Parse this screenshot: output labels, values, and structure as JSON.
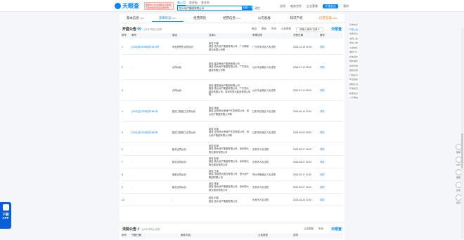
{
  "header": {
    "logo_text": "天眼查",
    "promo_text": "国家中小企业发展子基金旗下官方备案企业征信机构",
    "top_tabs": [
      "查公司",
      "查老板",
      "查关系"
    ],
    "search_value": "恒大地产集团有限公司",
    "search_button": "天眼一下",
    "search_clear": "清空",
    "right_items": [
      "应用",
      "商务合作",
      "企业套餐",
      "开通会员",
      "我的"
    ]
  },
  "nav": {
    "tabs": [
      {
        "label": "基本信息",
        "count": "999+"
      },
      {
        "label": "法律诉讼",
        "count": "999+"
      },
      {
        "label": "经营风险",
        "count": ""
      },
      {
        "label": "经营信息",
        "count": "999+"
      },
      {
        "label": "公司发展",
        "count": ""
      },
      {
        "label": "知识产权",
        "count": ""
      },
      {
        "label": "历史信息",
        "count": "999+"
      }
    ]
  },
  "section1": {
    "title": "开庭公告",
    "count": "99",
    "sub": "近5年开庭公告数",
    "filters": [
      "案由",
      "角色",
      "年份",
      "公告类型"
    ],
    "search_placeholder": "请输入案号/当事人",
    "brand": "天眼查",
    "columns": [
      "序号",
      "案号",
      "案由",
      "当事人",
      "审理法院",
      "开庭日期",
      "操作"
    ],
    "rows": [
      {
        "no": "1",
        "case": "(2024)粤0106民初14312号",
        "cause": "商品房预售合同纠纷",
        "party": "原告:刘某\n被告:恒大地产集团有限公司、广州御景置业有限公司等",
        "court": "广州市天河区人民法院",
        "date": "2024-12-18 14:15",
        "op": "详情"
      },
      {
        "no": "2",
        "case": "-",
        "cause": "合同纠纷",
        "party": "原告:建发房地产集团有限公司\n被告:恒大地产集团有限公司、广东恒大建设有限公司等",
        "court": "汕头市龙湖区人民法院",
        "date": "2024-07-12 09:00",
        "op": "详情"
      },
      {
        "no": "3",
        "case": "-",
        "cause": "合同纠纷",
        "party": "原告:建发房地产集团有限公司\n被告:恒大地产集团有限公司、广东恒大建设有限公司、深圳市恒大建设有限公司等",
        "court": "汕头市龙湖区人民法院",
        "date": "2024-07-10 09:00",
        "op": "详情"
      },
      {
        "no": "4",
        "case": "(2024)辽1002民初1861号",
        "cause": "建设工程施工合同纠纷",
        "party": "原告:张某\n被告:辽阳恒大房地产开发有限公司、恒大地产集团有限公司等",
        "court": "辽阳市白塔区人民法院",
        "date": "2024-06-14 10:00",
        "op": "详情"
      },
      {
        "no": "5",
        "case": "(2024)辽1002民初1863号",
        "cause": "建设工程施工合同纠纷",
        "party": "原告:孙某\n被告:辽阳恒大房地产开发有限公司、恒大地产集团有限公司等",
        "court": "辽阳市白塔区人民法院",
        "date": "2024-06-04 09:00",
        "op": "详情"
      },
      {
        "no": "6",
        "case": "-",
        "cause": "租赁合同纠纷",
        "party": "原告:彭某\n被告:恒大地产集团有限公司、深圳恒大物业服务有限公司",
        "court": "东莞市人民法院",
        "date": "2024-05-27 15:00",
        "op": "详情"
      },
      {
        "no": "7",
        "case": "-",
        "cause": "租赁合同纠纷",
        "party": "原告:彭某\n被告:恒大地产集团有限公司、深圳恒大物业服务有限公司",
        "court": "东莞市人民法院",
        "date": "2024-05-27 14:00",
        "op": "详情"
      },
      {
        "no": "8",
        "case": "-",
        "cause": "借款合同纠纷",
        "party": "原告:王某\n被告:中原恒大置业有限公司、恒大地产集团有限公司",
        "court": "郑州市管城区人民法院",
        "date": "2024-05-17 14:30",
        "op": "详情"
      },
      {
        "no": "9",
        "case": "-",
        "cause": "租赁合同纠纷",
        "party": "原告:李某\n被告:恒大地产集团有限公司、深圳恒大物业服务有限公司",
        "court": "东莞市人民法院",
        "date": "2024-05-27 14:30",
        "op": "详情"
      },
      {
        "no": "10",
        "case": "-",
        "cause": "-",
        "party": "原告:刘某\n被告:恒大地产集团有限公司",
        "court": "东莞市人民法院",
        "date": "2024-05-24 10:30",
        "op": "详情"
      }
    ]
  },
  "section2": {
    "title": "法院公告",
    "count": "4",
    "sub": "近5年法院公告数",
    "filters": [
      "公告类型",
      "年份"
    ],
    "brand": "天眼查",
    "columns": [
      "序号",
      "刊登日期",
      "案件内容",
      "公告类型",
      "法院"
    ]
  },
  "sidebar_right": [
    "基本信息",
    "开庭公告",
    "法律诉讼",
    "法院公告",
    "送达公告",
    "立案信息",
    "被执行人",
    "终本案件",
    "限制消费",
    "经营异常",
    "股权冻结",
    "行政处罚",
    "司法拍卖",
    "限制出境",
    "环保处罚",
    "税收违法",
    "公示催告"
  ],
  "float": [
    "帮助",
    "APP",
    "客服",
    "反馈",
    "置顶"
  ],
  "app_download": "下载APP"
}
